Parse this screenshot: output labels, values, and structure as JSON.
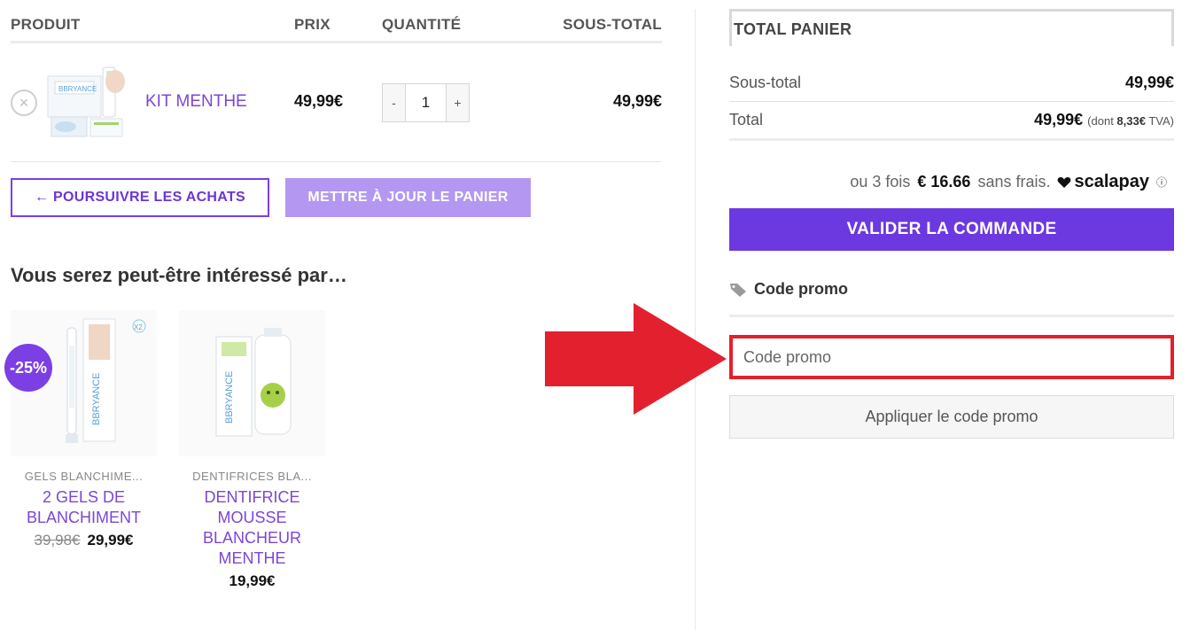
{
  "cart_table": {
    "headers": {
      "product": "PRODUIT",
      "price": "PRIX",
      "quantity": "QUANTITÉ",
      "subtotal": "SOUS-TOTAL"
    },
    "items": [
      {
        "remove": "×",
        "name": "KIT MENTHE",
        "price": "49,99€",
        "quantity": "1",
        "subtotal": "49,99€",
        "qty_minus": "-",
        "qty_plus": "+"
      }
    ]
  },
  "actions": {
    "continue_label": "← POURSUIVRE LES ACHATS",
    "update_label": "METTRE À JOUR LE PANIER"
  },
  "related": {
    "title": "Vous serez peut-être intéressé par…",
    "products": [
      {
        "badge": "-25%",
        "category": "GELS BLANCHIME...",
        "name_lines": [
          "2 GELS DE",
          "BLANCHIMENT"
        ],
        "old_price": "39,98€",
        "price": "29,99€",
        "brand_text": "BBRYANCE",
        "corner_tag": "X2"
      },
      {
        "category": "DENTIFRICES BLA...",
        "name_lines": [
          "DENTIFRICE",
          "MOUSSE",
          "BLANCHEUR",
          "MENTHE"
        ],
        "price": "19,99€",
        "brand_text": "BBRYANCE"
      }
    ]
  },
  "totals": {
    "title": "TOTAL PANIER",
    "subtotal_label": "Sous-total",
    "subtotal_value": "49,99€",
    "total_label": "Total",
    "total_value": "49,99€",
    "tva_prefix": "(dont ",
    "tva_amount": "8,33€",
    "tva_suffix": " TVA)"
  },
  "scalapay": {
    "prefix": "ou 3 fois",
    "amount": "€ 16.66",
    "suffix": "sans frais.",
    "brand": "scalapay",
    "info_icon": "ⓘ"
  },
  "checkout_label": "VALIDER LA COMMANDE",
  "promo": {
    "heading": "Code promo",
    "placeholder": "Code promo",
    "apply_label": "Appliquer le code promo"
  },
  "kit_thumb_brand": "BBRYANCE",
  "colors": {
    "accent": "#6c38e0",
    "link": "#7b47d6",
    "annotation_red": "#e3202e"
  }
}
